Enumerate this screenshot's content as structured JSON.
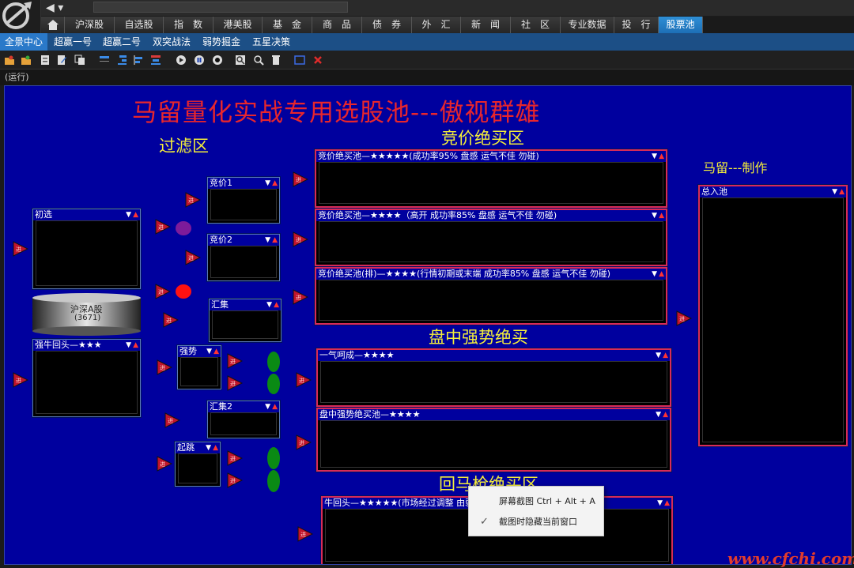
{
  "nav": {
    "back": "◀",
    "back_dropdown": "▾"
  },
  "main_tabs": [
    "沪深股",
    "自选股",
    "指　数",
    "港美股",
    "基　金",
    "商　品",
    "债　券",
    "外　汇",
    "新　闻",
    "社　区",
    "专业数据",
    "投　行",
    "股票池"
  ],
  "sub_tabs": [
    "全景中心",
    "超赢一号",
    "超赢二号",
    "双突战法",
    "弱势掘金",
    "五星决策"
  ],
  "status_text": "(运行)",
  "canvas": {
    "main_title": "马留量化实战专用选股池---傲视群雄",
    "filter_title": "过滤区",
    "auction_title": "竞价绝买区",
    "intraday_title": "盘中强势绝买",
    "pullback_title": "回马枪绝买区",
    "author_title": "马留---制作"
  },
  "panels": {
    "chuxuan": "初选",
    "qiangniu": "强牛回头—★★★",
    "jingjia1": "竞价1",
    "jingjia2": "竞价2",
    "huiji": "汇集",
    "qiangshi": "强势",
    "huiji2": "汇集2",
    "qitiao": "起跳",
    "pool1": "竞价绝买池—★★★★★(成功率95% 盘感 运气不佳 勿碰)",
    "pool2": "竞价绝买池—★★★★（高开 成功率85% 盘感 运气不佳 勿碰)",
    "pool3": "竞价绝买池(排)—★★★★(行情初期或末端 成功率85% 盘感 运气不佳 勿碰)",
    "pool4": "一气呵成—★★★★",
    "pool5": "盘中强势绝买池—★★★★",
    "pool6": "牛回头—★★★★★(市场经过调整 由弱转强",
    "total": "总入池"
  },
  "drum": {
    "line1": "沪深A股",
    "line2": "(3671)"
  },
  "context_menu": {
    "item1": "屏幕截图 Ctrl + Alt + A",
    "item2": "截图时隐藏当前窗口",
    "checked_item": 2
  },
  "watermark": "www.cfchi.com",
  "colors": {
    "canvas_bg": "#00009e",
    "title_red": "#e8262c",
    "zone_yellow": "#f4ee3a",
    "arrow_red": "#c0142c",
    "dot_purple": "#7d1b9a",
    "dot_red": "#ff1111",
    "dot_green": "#0a8a14"
  }
}
